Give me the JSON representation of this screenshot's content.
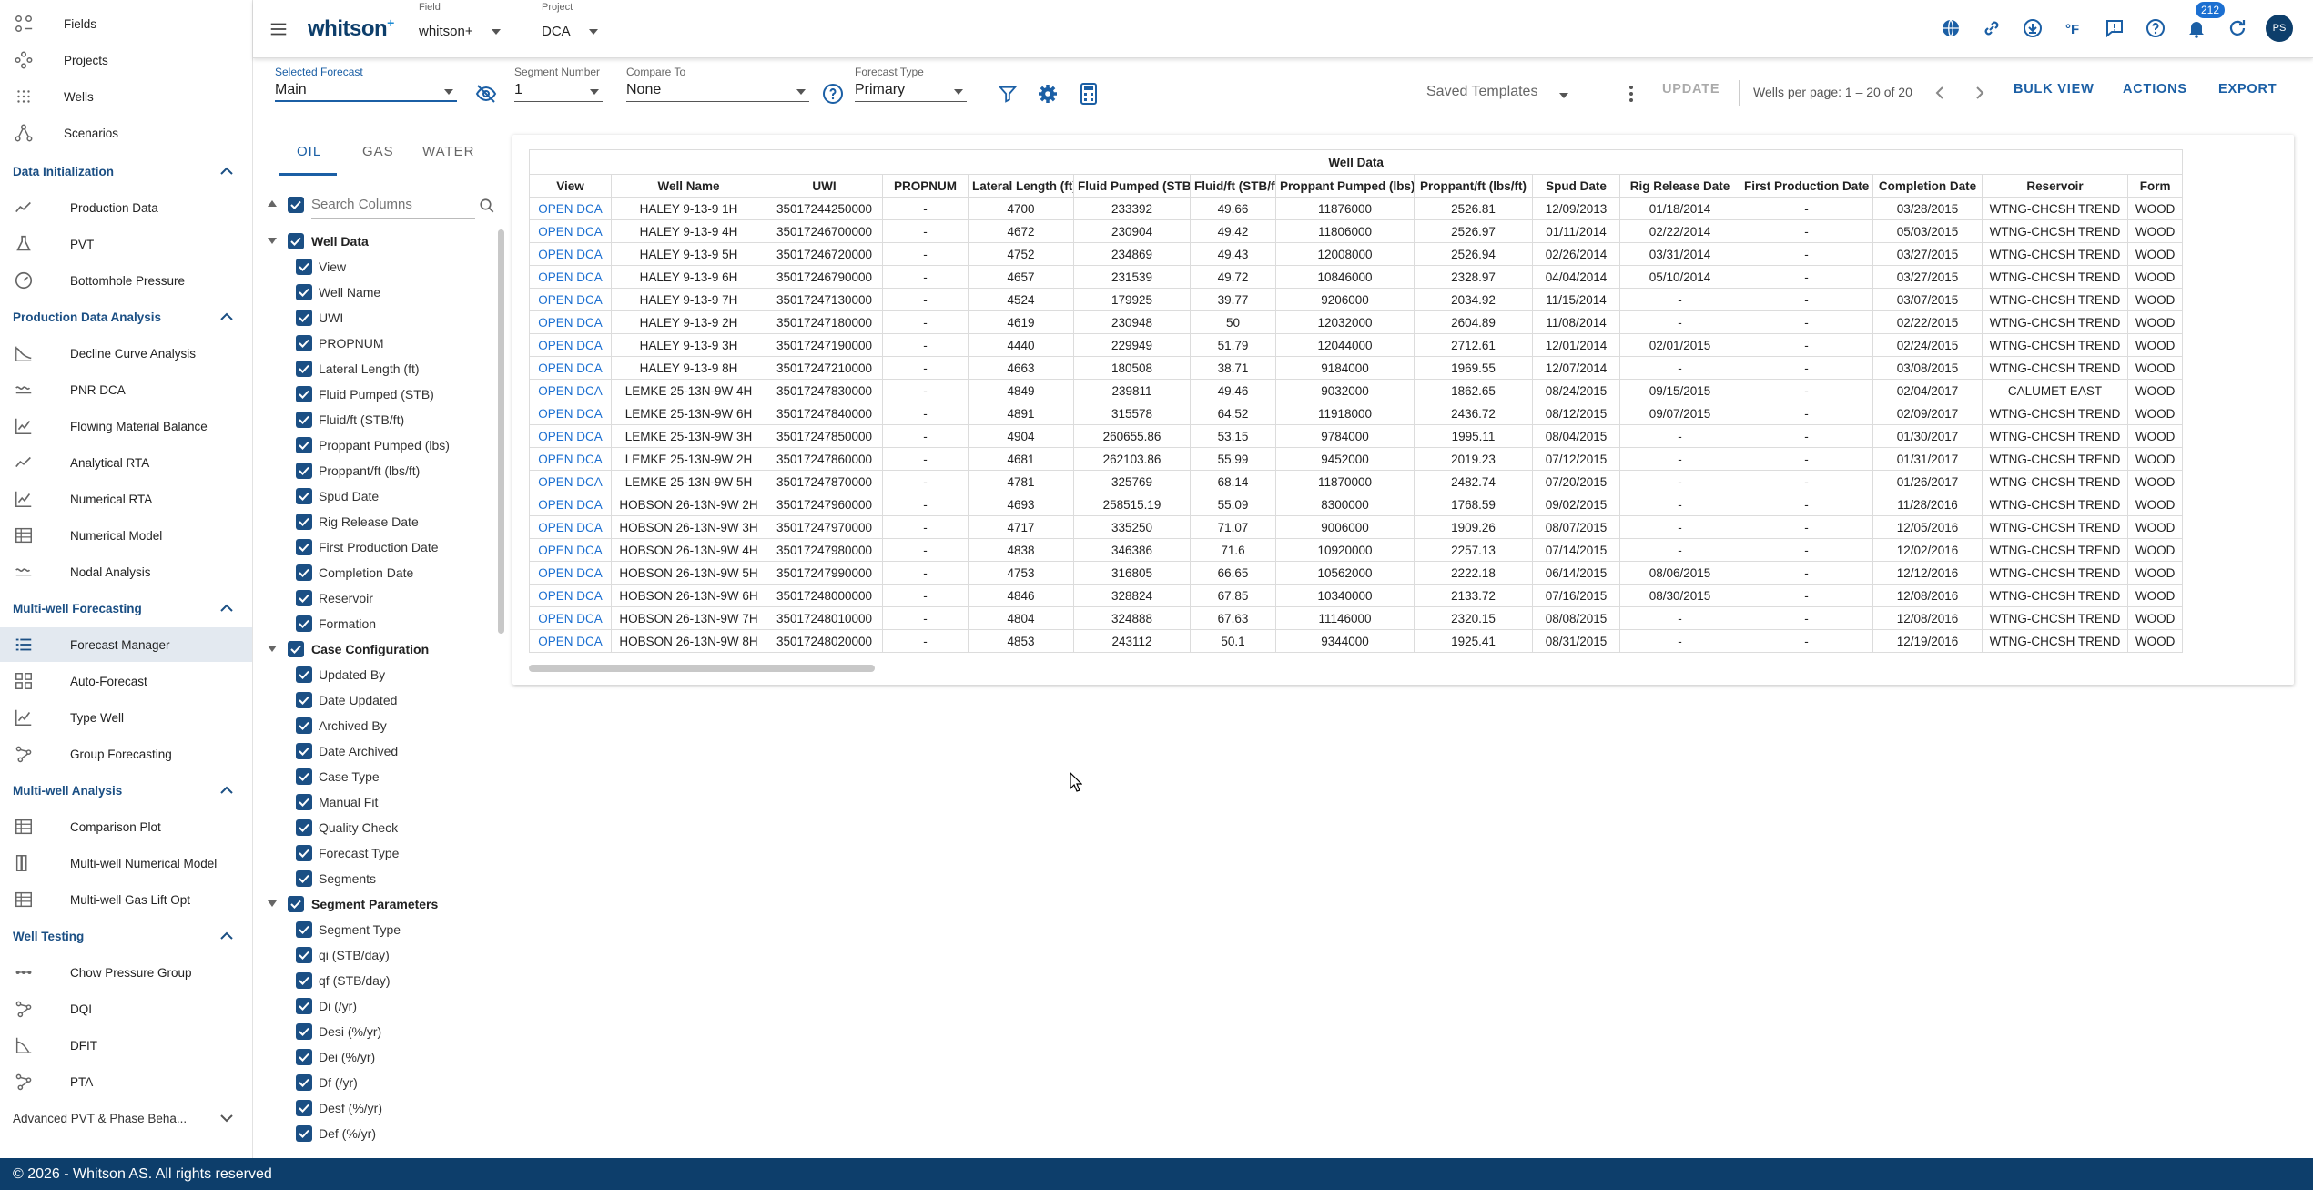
{
  "app": {
    "logo": "whitson",
    "logo_sup": "+"
  },
  "header": {
    "field_caption": "Field",
    "field_value": "whitson+",
    "project_caption": "Project",
    "project_value": "DCA",
    "notification_count": "212",
    "avatar_initials": "PS",
    "icons": [
      "globe-icon",
      "link-icon",
      "download-icon",
      "fahrenheit-icon",
      "feedback-icon",
      "help-icon",
      "bell-icon",
      "refresh-icon"
    ]
  },
  "nav": {
    "top": [
      {
        "label": "Fields",
        "icon": "fields-icon"
      },
      {
        "label": "Projects",
        "icon": "projects-icon"
      },
      {
        "label": "Wells",
        "icon": "wells-icon"
      },
      {
        "label": "Scenarios",
        "icon": "scenarios-icon"
      }
    ],
    "sections": [
      {
        "title": "Data Initialization",
        "items": [
          "Production Data",
          "PVT",
          "Bottomhole Pressure"
        ]
      },
      {
        "title": "Production Data Analysis",
        "items": [
          "Decline Curve Analysis",
          "PNR DCA",
          "Flowing Material Balance",
          "Analytical RTA",
          "Numerical RTA",
          "Numerical Model",
          "Nodal Analysis"
        ]
      },
      {
        "title": "Multi-well Forecasting",
        "items": [
          "Forecast Manager",
          "Auto-Forecast",
          "Type Well",
          "Group Forecasting"
        ]
      },
      {
        "title": "Multi-well Analysis",
        "items": [
          "Comparison Plot",
          "Multi-well Numerical Model",
          "Multi-well Gas Lift Opt"
        ]
      },
      {
        "title": "Well Testing",
        "items": [
          "Chow Pressure Group",
          "DQI",
          "DFIT",
          "PTA"
        ]
      },
      {
        "title": "Advanced PVT & Phase Beha...",
        "items": []
      }
    ],
    "active": "Forecast Manager"
  },
  "controls": {
    "selected_forecast_caption": "Selected Forecast",
    "selected_forecast_value": "Main",
    "segment_caption": "Segment Number",
    "segment_value": "1",
    "compare_caption": "Compare To",
    "compare_value": "None",
    "forecast_type_caption": "Forecast Type",
    "forecast_type_value": "Primary",
    "saved_templates_placeholder": "Saved Templates",
    "update_label": "UPDATE",
    "pagination": "Wells per page: 1 – 20 of 20",
    "bulk_view_label": "BULK VIEW",
    "actions_label": "ACTIONS",
    "export_label": "EXPORT"
  },
  "column_panel": {
    "tabs": [
      "OIL",
      "GAS",
      "WATER"
    ],
    "active_tab": "OIL",
    "search_placeholder": "Search Columns",
    "groups": [
      {
        "name": "Well Data",
        "items": [
          "View",
          "Well Name",
          "UWI",
          "PROPNUM",
          "Lateral Length (ft)",
          "Fluid Pumped (STB)",
          "Fluid/ft (STB/ft)",
          "Proppant Pumped (lbs)",
          "Proppant/ft (lbs/ft)",
          "Spud Date",
          "Rig Release Date",
          "First Production Date",
          "Completion Date",
          "Reservoir",
          "Formation"
        ]
      },
      {
        "name": "Case Configuration",
        "items": [
          "Updated By",
          "Date Updated",
          "Archived By",
          "Date Archived",
          "Case Type",
          "Manual Fit",
          "Quality Check",
          "Forecast Type",
          "Segments"
        ]
      },
      {
        "name": "Segment Parameters",
        "items": [
          "Segment Type",
          "qi (STB/day)",
          "qf (STB/day)",
          "Di (/yr)",
          "Desi (%/yr)",
          "Dei (%/yr)",
          "Df (/yr)",
          "Desf (%/yr)",
          "Def (%/yr)"
        ]
      }
    ]
  },
  "table": {
    "group_header": "Well Data",
    "columns": [
      "View",
      "Well Name",
      "UWI",
      "PROPNUM",
      "Lateral Length (ft)",
      "Fluid Pumped (STB)",
      "Fluid/ft (STB/ft)",
      "Proppant Pumped (lbs)",
      "Proppant/ft (lbs/ft)",
      "Spud Date",
      "Rig Release Date",
      "First Production Date",
      "Completion Date",
      "Reservoir",
      "Form"
    ],
    "rows": [
      [
        "OPEN DCA",
        "HALEY 9-13-9 1H",
        "35017244250000",
        "-",
        "4700",
        "233392",
        "49.66",
        "11876000",
        "2526.81",
        "12/09/2013",
        "01/18/2014",
        "-",
        "03/28/2015",
        "WTNG-CHCSH TREND",
        "WOOD"
      ],
      [
        "OPEN DCA",
        "HALEY 9-13-9 4H",
        "35017246700000",
        "-",
        "4672",
        "230904",
        "49.42",
        "11806000",
        "2526.97",
        "01/11/2014",
        "02/22/2014",
        "-",
        "05/03/2015",
        "WTNG-CHCSH TREND",
        "WOOD"
      ],
      [
        "OPEN DCA",
        "HALEY 9-13-9 5H",
        "35017246720000",
        "-",
        "4752",
        "234869",
        "49.43",
        "12008000",
        "2526.94",
        "02/26/2014",
        "03/31/2014",
        "-",
        "03/27/2015",
        "WTNG-CHCSH TREND",
        "WOOD"
      ],
      [
        "OPEN DCA",
        "HALEY 9-13-9 6H",
        "35017246790000",
        "-",
        "4657",
        "231539",
        "49.72",
        "10846000",
        "2328.97",
        "04/04/2014",
        "05/10/2014",
        "-",
        "03/27/2015",
        "WTNG-CHCSH TREND",
        "WOOD"
      ],
      [
        "OPEN DCA",
        "HALEY 9-13-9 7H",
        "35017247130000",
        "-",
        "4524",
        "179925",
        "39.77",
        "9206000",
        "2034.92",
        "11/15/2014",
        "-",
        "-",
        "03/07/2015",
        "WTNG-CHCSH TREND",
        "WOOD"
      ],
      [
        "OPEN DCA",
        "HALEY 9-13-9 2H",
        "35017247180000",
        "-",
        "4619",
        "230948",
        "50",
        "12032000",
        "2604.89",
        "11/08/2014",
        "-",
        "-",
        "02/22/2015",
        "WTNG-CHCSH TREND",
        "WOOD"
      ],
      [
        "OPEN DCA",
        "HALEY 9-13-9 3H",
        "35017247190000",
        "-",
        "4440",
        "229949",
        "51.79",
        "12044000",
        "2712.61",
        "12/01/2014",
        "02/01/2015",
        "-",
        "02/24/2015",
        "WTNG-CHCSH TREND",
        "WOOD"
      ],
      [
        "OPEN DCA",
        "HALEY 9-13-9 8H",
        "35017247210000",
        "-",
        "4663",
        "180508",
        "38.71",
        "9184000",
        "1969.55",
        "12/07/2014",
        "-",
        "-",
        "03/08/2015",
        "WTNG-CHCSH TREND",
        "WOOD"
      ],
      [
        "OPEN DCA",
        "LEMKE 25-13N-9W 4H",
        "35017247830000",
        "-",
        "4849",
        "239811",
        "49.46",
        "9032000",
        "1862.65",
        "08/24/2015",
        "09/15/2015",
        "-",
        "02/04/2017",
        "CALUMET EAST",
        "WOOD"
      ],
      [
        "OPEN DCA",
        "LEMKE 25-13N-9W 6H",
        "35017247840000",
        "-",
        "4891",
        "315578",
        "64.52",
        "11918000",
        "2436.72",
        "08/12/2015",
        "09/07/2015",
        "-",
        "02/09/2017",
        "WTNG-CHCSH TREND",
        "WOOD"
      ],
      [
        "OPEN DCA",
        "LEMKE 25-13N-9W 3H",
        "35017247850000",
        "-",
        "4904",
        "260655.86",
        "53.15",
        "9784000",
        "1995.11",
        "08/04/2015",
        "-",
        "-",
        "01/30/2017",
        "WTNG-CHCSH TREND",
        "WOOD"
      ],
      [
        "OPEN DCA",
        "LEMKE 25-13N-9W 2H",
        "35017247860000",
        "-",
        "4681",
        "262103.86",
        "55.99",
        "9452000",
        "2019.23",
        "07/12/2015",
        "-",
        "-",
        "01/31/2017",
        "WTNG-CHCSH TREND",
        "WOOD"
      ],
      [
        "OPEN DCA",
        "LEMKE 25-13N-9W 5H",
        "35017247870000",
        "-",
        "4781",
        "325769",
        "68.14",
        "11870000",
        "2482.74",
        "07/20/2015",
        "-",
        "-",
        "01/26/2017",
        "WTNG-CHCSH TREND",
        "WOOD"
      ],
      [
        "OPEN DCA",
        "HOBSON 26-13N-9W 2H",
        "35017247960000",
        "-",
        "4693",
        "258515.19",
        "55.09",
        "8300000",
        "1768.59",
        "09/02/2015",
        "-",
        "-",
        "11/28/2016",
        "WTNG-CHCSH TREND",
        "WOOD"
      ],
      [
        "OPEN DCA",
        "HOBSON 26-13N-9W 3H",
        "35017247970000",
        "-",
        "4717",
        "335250",
        "71.07",
        "9006000",
        "1909.26",
        "08/07/2015",
        "-",
        "-",
        "12/05/2016",
        "WTNG-CHCSH TREND",
        "WOOD"
      ],
      [
        "OPEN DCA",
        "HOBSON 26-13N-9W 4H",
        "35017247980000",
        "-",
        "4838",
        "346386",
        "71.6",
        "10920000",
        "2257.13",
        "07/14/2015",
        "-",
        "-",
        "12/02/2016",
        "WTNG-CHCSH TREND",
        "WOOD"
      ],
      [
        "OPEN DCA",
        "HOBSON 26-13N-9W 5H",
        "35017247990000",
        "-",
        "4753",
        "316805",
        "66.65",
        "10562000",
        "2222.18",
        "06/14/2015",
        "08/06/2015",
        "-",
        "12/12/2016",
        "WTNG-CHCSH TREND",
        "WOOD"
      ],
      [
        "OPEN DCA",
        "HOBSON 26-13N-9W 6H",
        "35017248000000",
        "-",
        "4846",
        "328824",
        "67.85",
        "10340000",
        "2133.72",
        "07/16/2015",
        "08/30/2015",
        "-",
        "12/08/2016",
        "WTNG-CHCSH TREND",
        "WOOD"
      ],
      [
        "OPEN DCA",
        "HOBSON 26-13N-9W 7H",
        "35017248010000",
        "-",
        "4804",
        "324888",
        "67.63",
        "11146000",
        "2320.15",
        "08/08/2015",
        "-",
        "-",
        "12/08/2016",
        "WTNG-CHCSH TREND",
        "WOOD"
      ],
      [
        "OPEN DCA",
        "HOBSON 26-13N-9W 8H",
        "35017248020000",
        "-",
        "4853",
        "243112",
        "50.1",
        "9344000",
        "1925.41",
        "08/31/2015",
        "-",
        "-",
        "12/19/2016",
        "WTNG-CHCSH TREND",
        "WOOD"
      ]
    ]
  },
  "footer": {
    "text": "© 2026 - Whitson AS. All rights reserved"
  },
  "colors": {
    "primary": "#1b5fa5",
    "navy": "#0d3e6b",
    "link": "#1b6fd1",
    "active_bg": "#e3e9f0"
  }
}
